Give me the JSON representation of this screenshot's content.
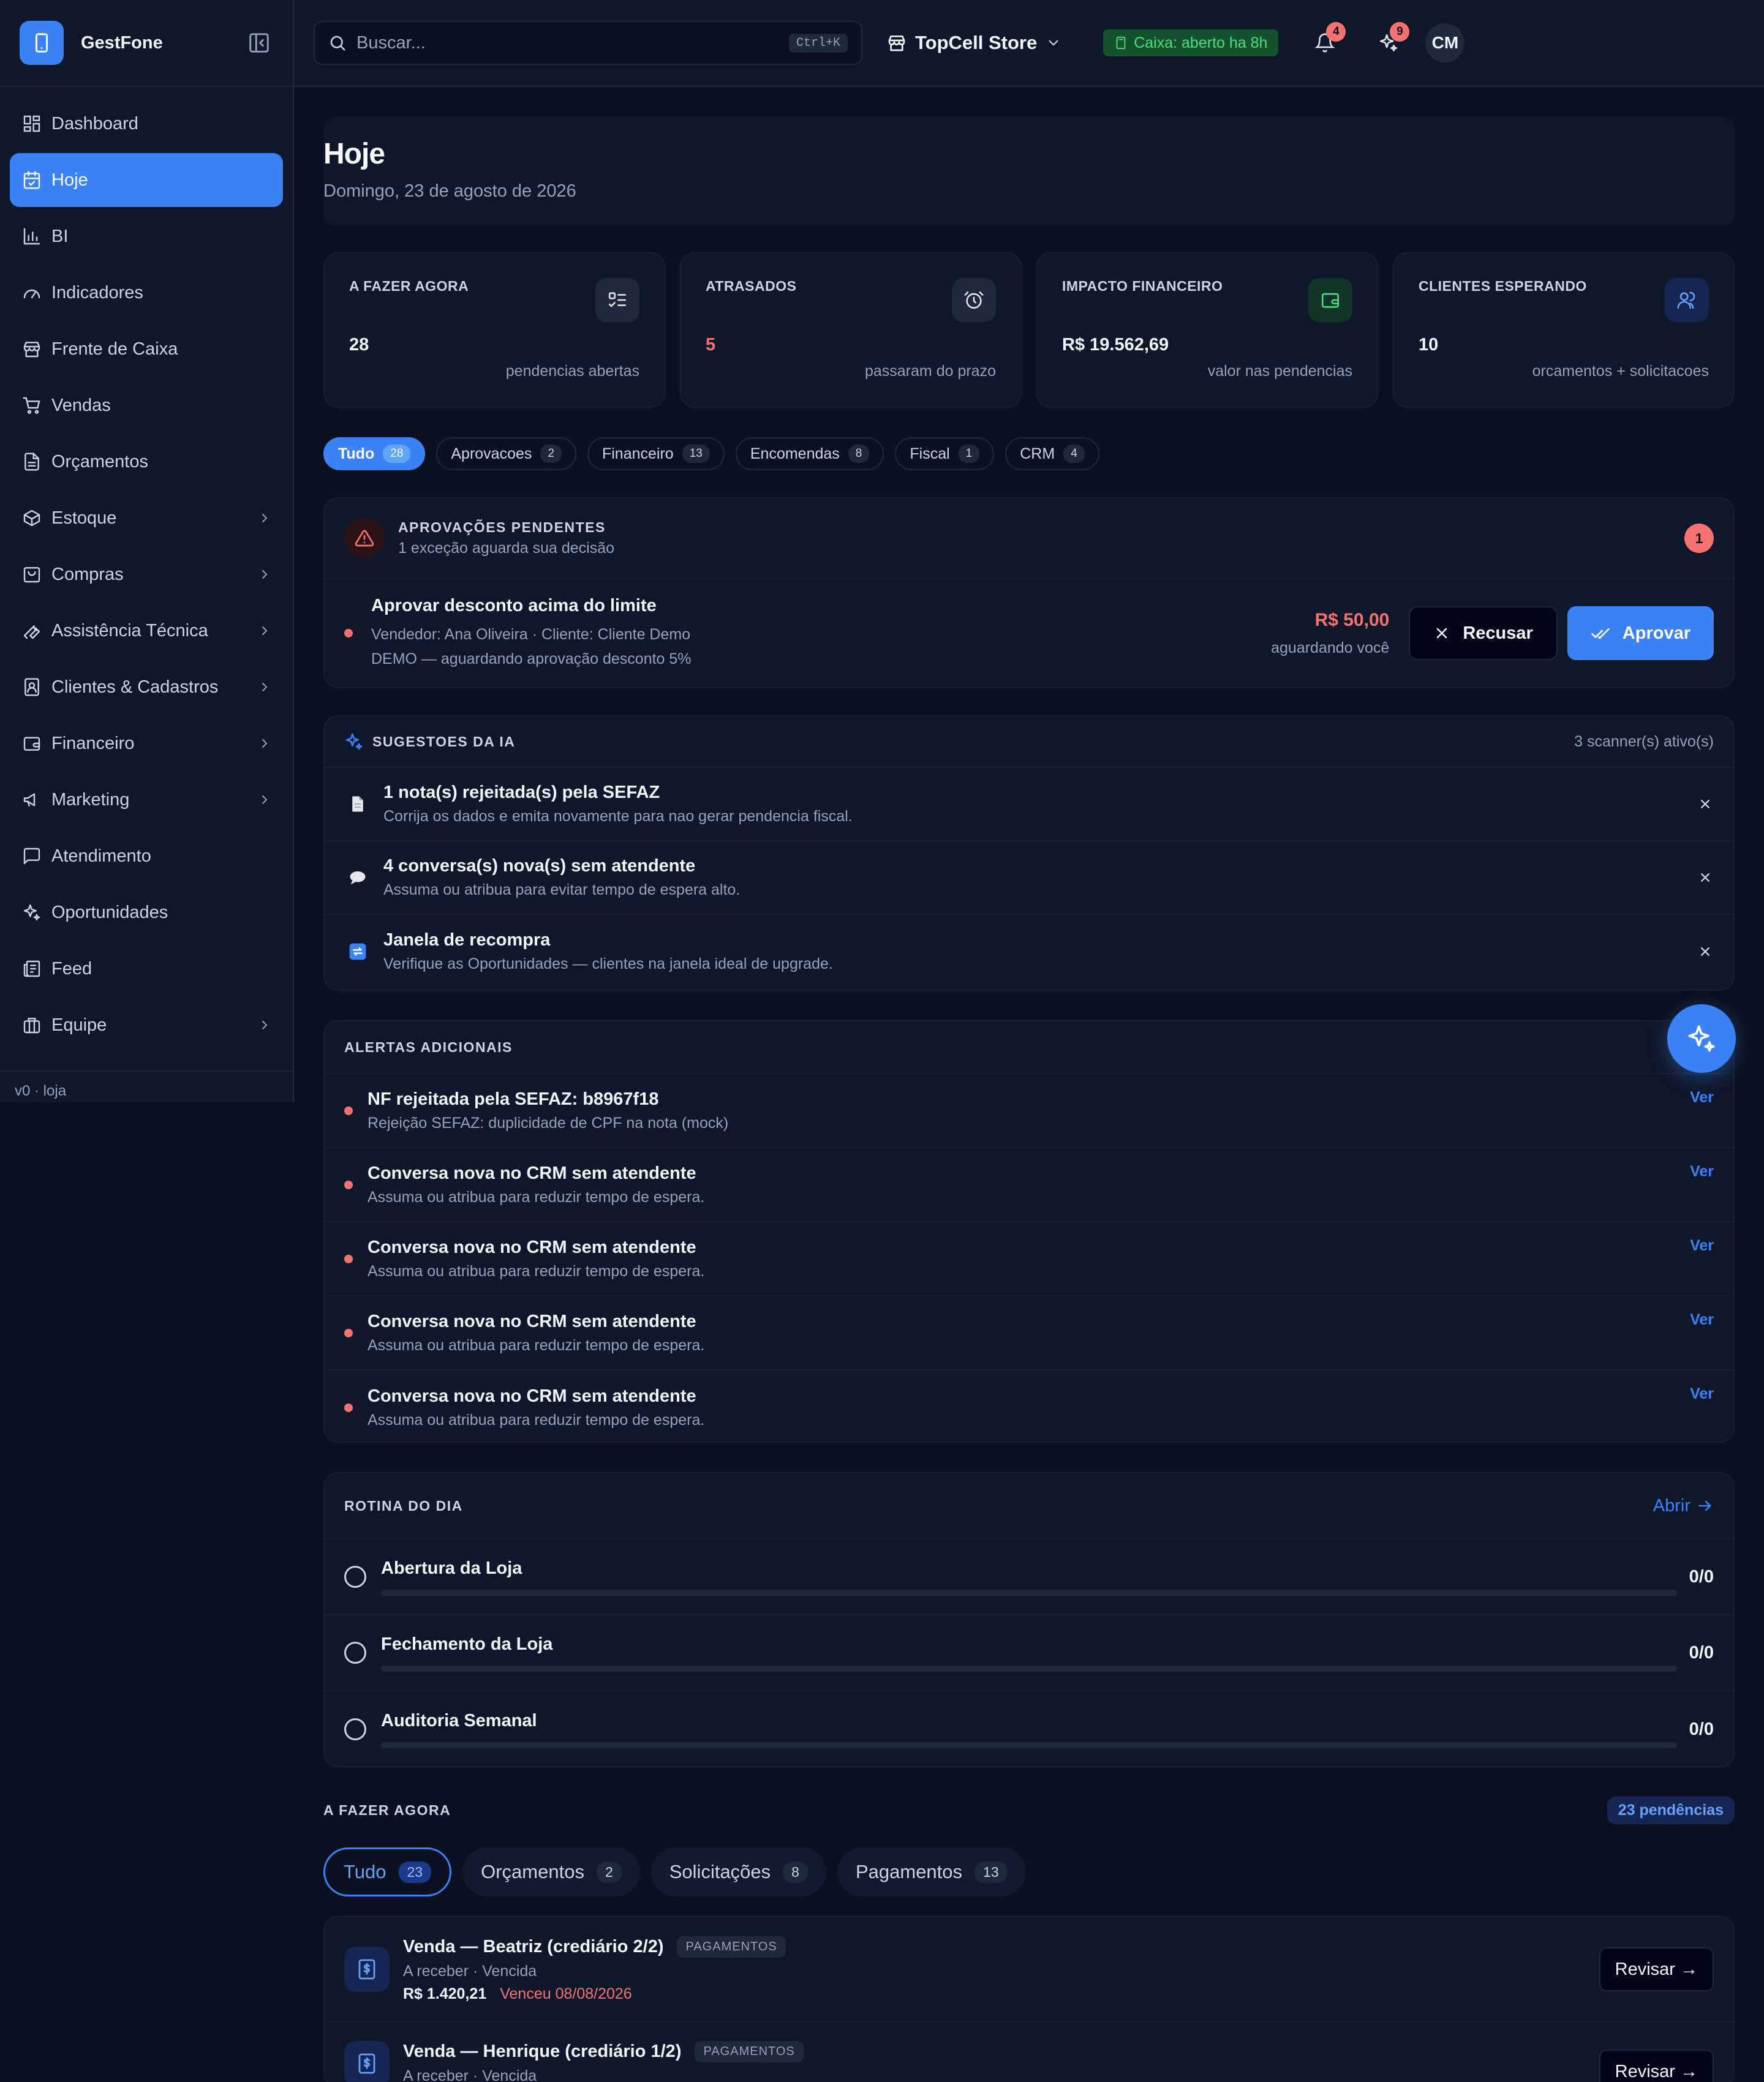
{
  "sidebar": {
    "brand": "GestFone",
    "items": [
      {
        "label": "Dashboard"
      },
      {
        "label": "Hoje"
      },
      {
        "label": "BI"
      },
      {
        "label": "Indicadores"
      },
      {
        "label": "Frente de Caixa"
      },
      {
        "label": "Vendas"
      },
      {
        "label": "Orçamentos"
      },
      {
        "label": "Estoque"
      },
      {
        "label": "Compras"
      },
      {
        "label": "Assistência Técnica"
      },
      {
        "label": "Clientes & Cadastros"
      },
      {
        "label": "Financeiro"
      },
      {
        "label": "Marketing"
      },
      {
        "label": "Atendimento"
      },
      {
        "label": "Oportunidades"
      },
      {
        "label": "Feed"
      },
      {
        "label": "Equipe"
      }
    ],
    "footer": "v0 · loja"
  },
  "header": {
    "search_placeholder": "Buscar...",
    "shortcut": "Ctrl+K",
    "store": "TopCell Store",
    "caixa_status": "Caixa: aberto ha 8h",
    "notif_count": "4",
    "ai_count": "9",
    "user_initials": "CM"
  },
  "colors": {
    "accent": "#3b82f6",
    "danger": "#f87171",
    "success": "#4ade80",
    "background": "#0b1120"
  },
  "page": {
    "title": "Hoje",
    "date": "Domingo, 23 de agosto de 2026"
  },
  "stats": [
    {
      "label": "A FAZER AGORA",
      "value": "28",
      "desc": "pendencias abertas"
    },
    {
      "label": "ATRASADOS",
      "value": "5",
      "desc": "passaram do prazo"
    },
    {
      "label": "IMPACTO FINANCEIRO",
      "value": "R$ 19.562,69",
      "desc": "valor nas pendencias"
    },
    {
      "label": "CLIENTES ESPERANDO",
      "value": "10",
      "desc": "orcamentos + solicitacoes"
    }
  ],
  "filters": [
    {
      "label": "Tudo",
      "count": "28"
    },
    {
      "label": "Aprovacoes",
      "count": "2"
    },
    {
      "label": "Financeiro",
      "count": "13"
    },
    {
      "label": "Encomendas",
      "count": "8"
    },
    {
      "label": "Fiscal",
      "count": "1"
    },
    {
      "label": "CRM",
      "count": "4"
    }
  ],
  "approvals": {
    "title": "APROVAÇÕES PENDENTES",
    "subtitle": "1 exceção aguarda sua decisão",
    "count": "1",
    "item": {
      "title": "Aprovar desconto acima do limite",
      "meta1": "Vendedor: Ana Oliveira · Cliente: Cliente Demo",
      "meta2": "DEMO — aguardando aprovação desconto 5%",
      "amount": "R$ 50,00",
      "waiting": "aguardando você",
      "reject": "Recusar",
      "approve": "Aprovar"
    }
  },
  "ai": {
    "title": "SUGESTOES DA IA",
    "status": "3 scanner(s) ativo(s)",
    "items": [
      {
        "title": "1 nota(s) rejeitada(s) pela SEFAZ",
        "desc": "Corrija os dados e emita novamente para nao gerar pendencia fiscal."
      },
      {
        "title": "4 conversa(s) nova(s) sem atendente",
        "desc": "Assuma ou atribua para evitar tempo de espera alto."
      },
      {
        "title": "Janela de recompra",
        "desc": "Verifique as Oportunidades — clientes na janela ideal de upgrade."
      }
    ]
  },
  "alerts": {
    "title": "ALERTAS ADICIONAIS",
    "action": "Ver",
    "items": [
      {
        "title": "NF rejeitada pela SEFAZ: b8967f18",
        "desc": "Rejeição SEFAZ: duplicidade de CPF na nota (mock)"
      },
      {
        "title": "Conversa nova no CRM sem atendente",
        "desc": "Assuma ou atribua para reduzir tempo de espera."
      },
      {
        "title": "Conversa nova no CRM sem atendente",
        "desc": "Assuma ou atribua para reduzir tempo de espera."
      },
      {
        "title": "Conversa nova no CRM sem atendente",
        "desc": "Assuma ou atribua para reduzir tempo de espera."
      },
      {
        "title": "Conversa nova no CRM sem atendente",
        "desc": "Assuma ou atribua para reduzir tempo de espera."
      }
    ]
  },
  "routine": {
    "title": "ROTINA DO DIA",
    "open": "Abrir",
    "items": [
      {
        "title": "Abertura da Loja",
        "value": "0/0",
        "progress": 0
      },
      {
        "title": "Fechamento da Loja",
        "value": "0/0",
        "progress": 0
      },
      {
        "title": "Auditoria Semanal",
        "value": "0/0",
        "progress": 0
      }
    ]
  },
  "todo": {
    "title": "A FAZER AGORA",
    "badge": "23 pendências",
    "tabs": [
      {
        "label": "Tudo",
        "count": "23"
      },
      {
        "label": "Orçamentos",
        "count": "2"
      },
      {
        "label": "Solicitações",
        "count": "8"
      },
      {
        "label": "Pagamentos",
        "count": "13"
      }
    ],
    "review": "Revisar →",
    "items": [
      {
        "title": "Venda — Beatriz (crediário 2/2)",
        "category": "PAGAMENTOS",
        "meta": "A receber · Vencida",
        "amount": "R$ 1.420,21",
        "due": "Venceu 08/08/2026"
      },
      {
        "title": "Venda — Henrique (crediário 1/2)",
        "category": "PAGAMENTOS",
        "meta": "A receber · Vencida"
      }
    ]
  }
}
